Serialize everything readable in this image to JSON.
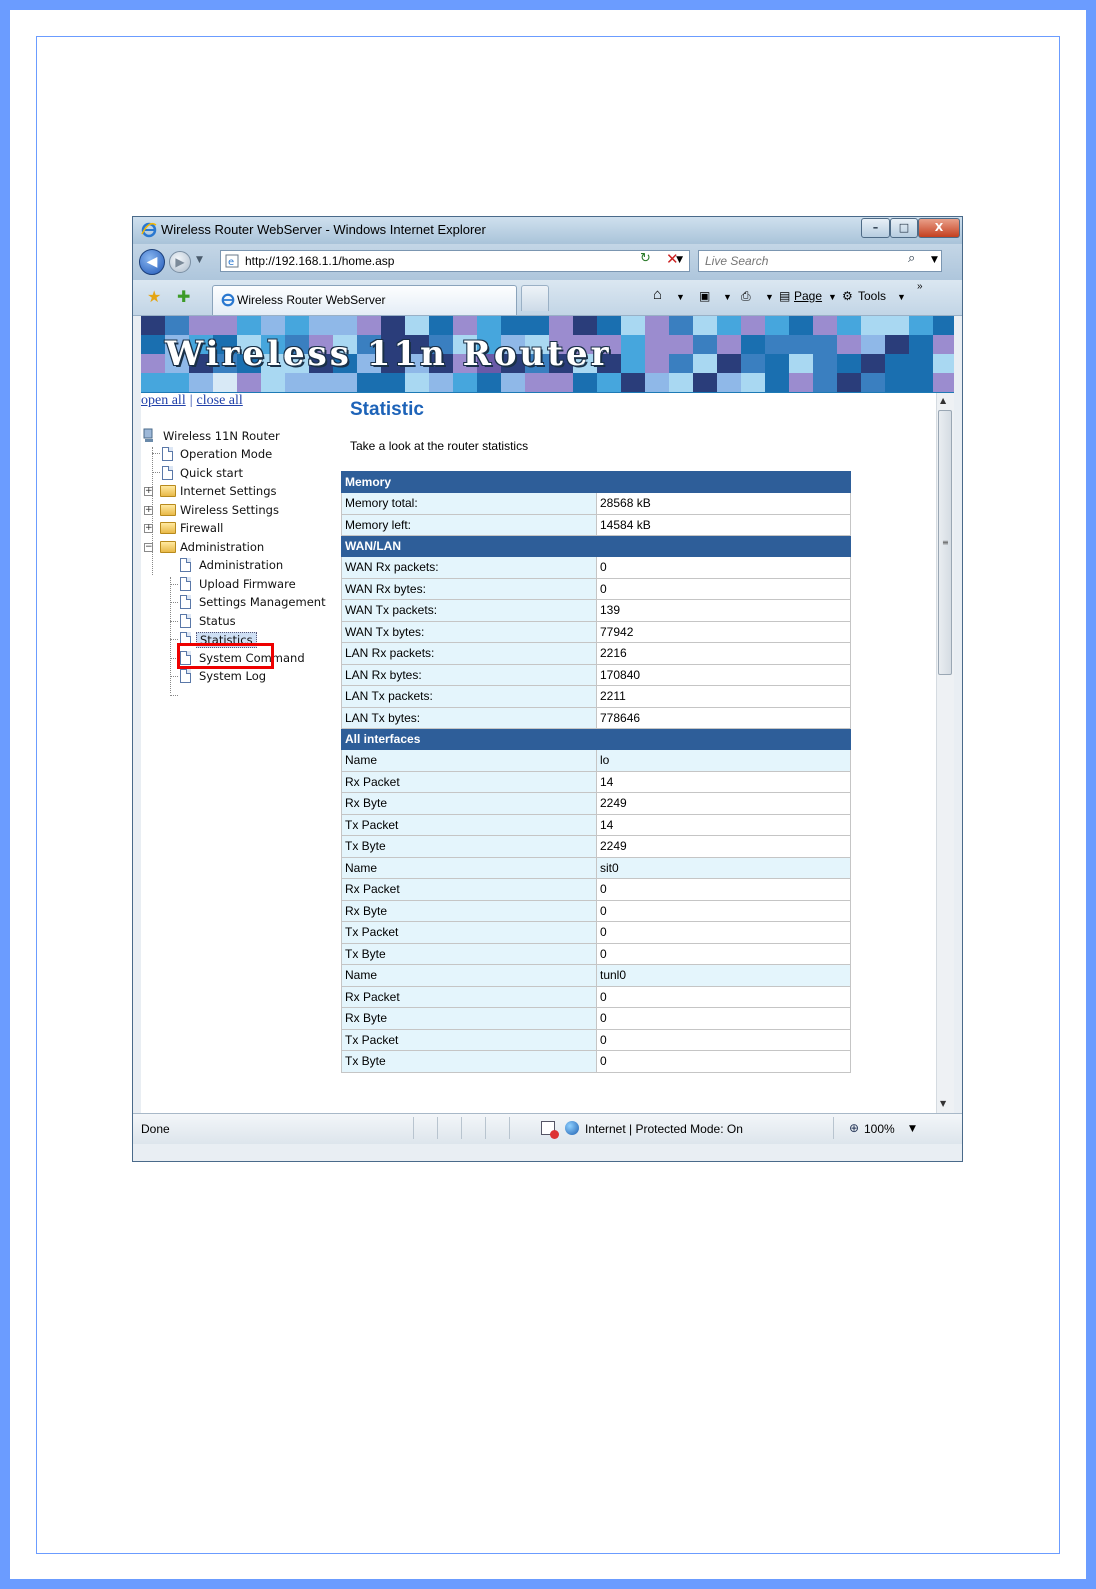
{
  "window": {
    "title": "Wireless Router WebServer - Windows Internet Explorer",
    "controls": {
      "minimize": "–",
      "maximize": "□",
      "close": "X"
    }
  },
  "address_bar": {
    "url": "http://192.168.1.1/home.asp",
    "search_placeholder": "Live Search"
  },
  "tab": {
    "label": "Wireless Router WebServer"
  },
  "command_bar": {
    "page_label": "Page",
    "tools_label": "Tools"
  },
  "banner": {
    "title": "Wireless 11n Router"
  },
  "sidebar": {
    "open_all": "open all",
    "close_all": "close all",
    "separator": "|",
    "root": "Wireless 11N Router",
    "items": [
      {
        "label": "Operation Mode"
      },
      {
        "label": "Quick start"
      },
      {
        "label": "Internet Settings"
      },
      {
        "label": "Wireless Settings"
      },
      {
        "label": "Firewall"
      },
      {
        "label": "Administration"
      },
      {
        "label": "Administration"
      },
      {
        "label": "Upload Firmware"
      },
      {
        "label": "Settings Management"
      },
      {
        "label": "Status"
      },
      {
        "label": "Statistics"
      },
      {
        "label": "System Command"
      },
      {
        "label": "System Log"
      }
    ]
  },
  "main": {
    "title": "Statistic",
    "subtitle": "Take a look at the router statistics",
    "memory": {
      "header": "Memory",
      "rows": [
        {
          "k": "Memory total:",
          "v": "28568 kB"
        },
        {
          "k": "Memory left:",
          "v": "14584 kB"
        }
      ]
    },
    "wanlan": {
      "header": "WAN/LAN",
      "rows": [
        {
          "k": "WAN Rx packets:",
          "v": "0"
        },
        {
          "k": "WAN Rx bytes:",
          "v": "0"
        },
        {
          "k": "WAN Tx packets:",
          "v": "139"
        },
        {
          "k": "WAN Tx bytes:",
          "v": "77942"
        },
        {
          "k": "LAN Rx packets:",
          "v": "2216"
        },
        {
          "k": "LAN Rx bytes:",
          "v": "170840"
        },
        {
          "k": "LAN Tx packets:",
          "v": "2211"
        },
        {
          "k": "LAN Tx bytes:",
          "v": "778646"
        }
      ]
    },
    "interfaces": {
      "header": "All interfaces",
      "rows": [
        {
          "k": "Name",
          "v": "lo"
        },
        {
          "k": "Rx Packet",
          "v": "14"
        },
        {
          "k": "Rx Byte",
          "v": "2249"
        },
        {
          "k": "Tx Packet",
          "v": "14"
        },
        {
          "k": "Tx Byte",
          "v": "2249"
        },
        {
          "k": "Name",
          "v": "sit0"
        },
        {
          "k": "Rx Packet",
          "v": "0"
        },
        {
          "k": "Rx Byte",
          "v": "0"
        },
        {
          "k": "Tx Packet",
          "v": "0"
        },
        {
          "k": "Tx Byte",
          "v": "0"
        },
        {
          "k": "Name",
          "v": "tunl0"
        },
        {
          "k": "Rx Packet",
          "v": "0"
        },
        {
          "k": "Rx Byte",
          "v": "0"
        },
        {
          "k": "Tx Packet",
          "v": "0"
        },
        {
          "k": "Tx Byte",
          "v": "0"
        }
      ]
    }
  },
  "status_bar": {
    "status": "Done",
    "zone": "Internet | Protected Mode: On",
    "zoom": "100%"
  }
}
